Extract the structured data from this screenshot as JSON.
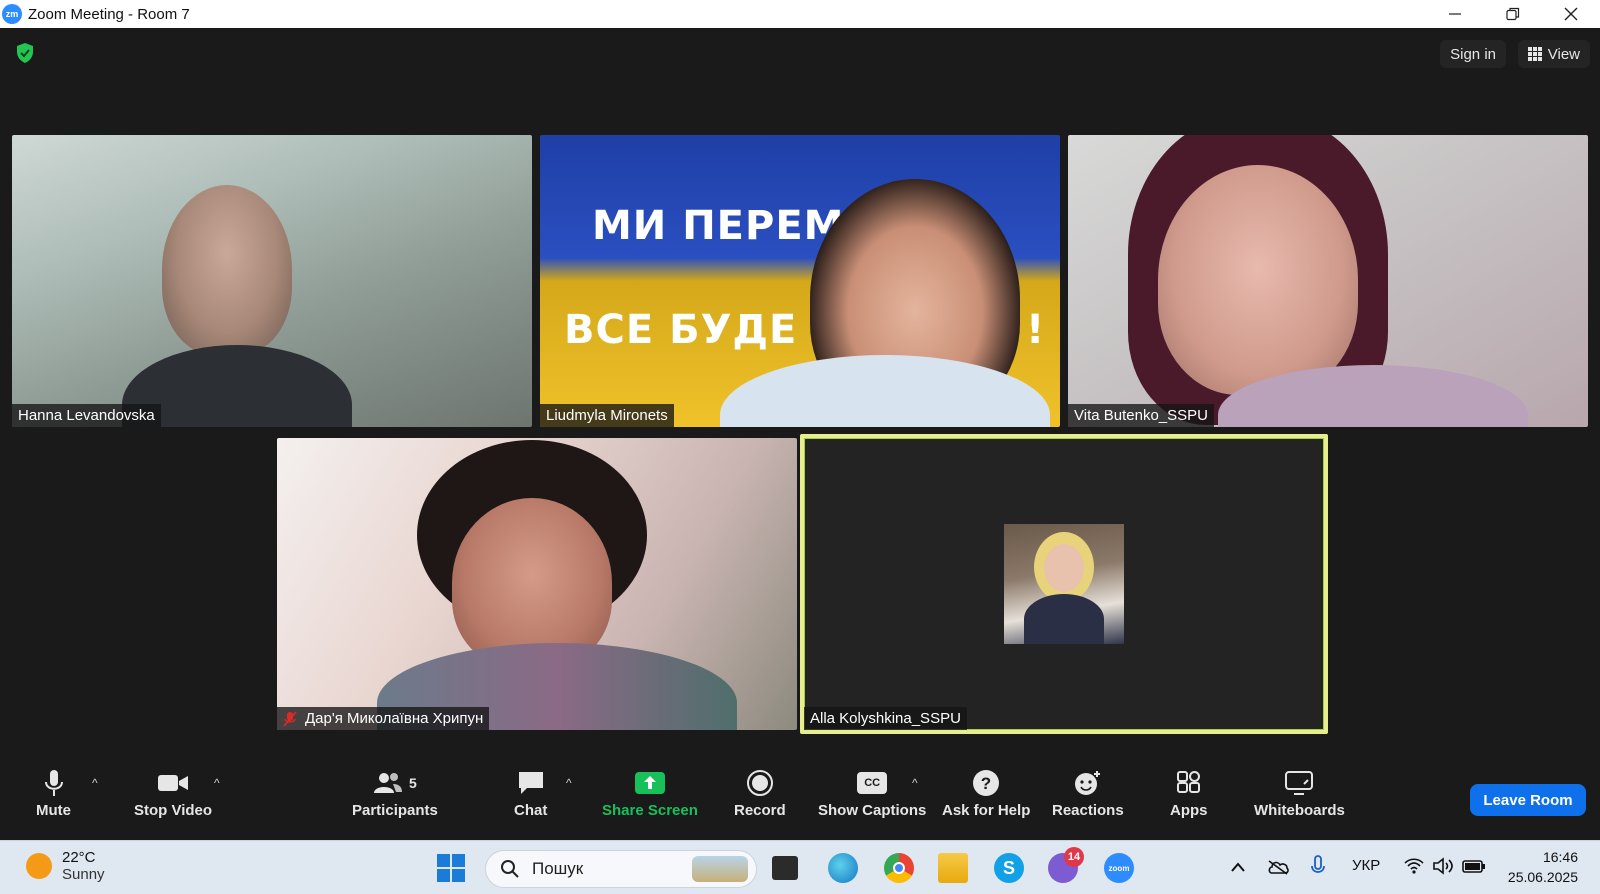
{
  "window": {
    "logo": "zm",
    "title": "Zoom Meeting - Room 7"
  },
  "meeting": {
    "sign_in": "Sign in",
    "view": "View"
  },
  "participants": [
    {
      "name": "Hanna Levandovska",
      "muted": false
    },
    {
      "name": "Liudmyla Mironets",
      "muted": false,
      "banner_lines": [
        "МИ ПЕРЕМО",
        "ВСЕ БУДЕ",
        "!"
      ]
    },
    {
      "name": "Vita Butenko_SSPU",
      "muted": false
    },
    {
      "name": "Дар'я Миколаївна Хрипун",
      "muted": true
    },
    {
      "name": "Alla Kolyshkina_SSPU",
      "muted": false,
      "active_speaker": true
    }
  ],
  "toolbar": {
    "mute": "Mute",
    "stop_video": "Stop Video",
    "participants": "Participants",
    "participants_count": "5",
    "chat": "Chat",
    "share_screen": "Share Screen",
    "record": "Record",
    "show_captions": "Show Captions",
    "captions_icon": "CC",
    "ask_for_help": "Ask for Help",
    "reactions": "Reactions",
    "apps": "Apps",
    "whiteboards": "Whiteboards",
    "leave_room": "Leave Room"
  },
  "taskbar": {
    "weather_temp": "22°C",
    "weather_desc": "Sunny",
    "search_placeholder": "Пошук",
    "viber_badge": "14",
    "zoom_label": "zoom",
    "language": "УКР",
    "time": "16:46",
    "date": "25.06.2025"
  },
  "colors": {
    "zoom_blue": "#0e71eb",
    "share_green": "#18c05a",
    "active_speaker_border": "#e6ee8f",
    "meeting_bg": "#1a1a1a",
    "taskbar_bg": "#dfe7f1"
  }
}
